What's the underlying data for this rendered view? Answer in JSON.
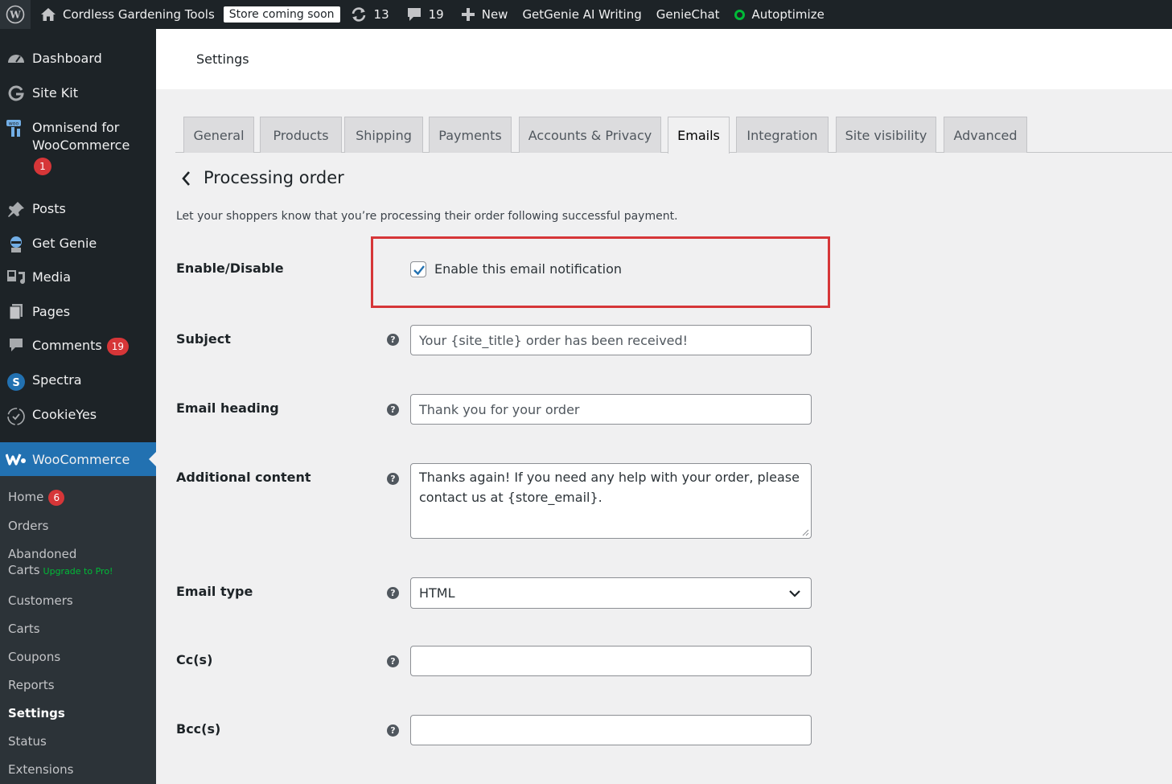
{
  "adminbar": {
    "site_name": "Cordless Gardening Tools",
    "store_badge": "Store coming soon",
    "updates_count": "13",
    "comments_count": "19",
    "new_label": "New",
    "getgenie_label": "GetGenie AI Writing",
    "geniechat_label": "GenieChat",
    "autoptimize_label": "Autoptimize"
  },
  "sidebar": {
    "items": [
      {
        "label": "Dashboard"
      },
      {
        "label": "Site Kit"
      },
      {
        "label": "Omnisend for WooCommerce",
        "badge": "1"
      },
      {
        "label": "Posts"
      },
      {
        "label": "Get Genie"
      },
      {
        "label": "Media"
      },
      {
        "label": "Pages"
      },
      {
        "label": "Comments",
        "badge": "19"
      },
      {
        "label": "Spectra"
      },
      {
        "label": "CookieYes"
      }
    ],
    "active": "WooCommerce",
    "submenu": {
      "home": "Home",
      "home_badge": "6",
      "orders": "Orders",
      "abandoned": "Abandoned",
      "carts_label": "Carts",
      "upgrade": "Upgrade to Pro!",
      "customers": "Customers",
      "carts": "Carts",
      "coupons": "Coupons",
      "reports": "Reports",
      "settings": "Settings",
      "status": "Status",
      "extensions": "Extensions"
    }
  },
  "header": {
    "title": "Settings"
  },
  "tabs": [
    "General",
    "Products",
    "Shipping",
    "Payments",
    "Accounts & Privacy",
    "Emails",
    "Integration",
    "Site visibility",
    "Advanced"
  ],
  "active_tab": "Emails",
  "page": {
    "title": "Processing order",
    "description": "Let your shoppers know that you’re processing their order following successful payment."
  },
  "form": {
    "enable_label": "Enable/Disable",
    "enable_checkbox_label": "Enable this email notification",
    "enable_checked": true,
    "subject_label": "Subject",
    "subject_placeholder": "Your {site_title} order has been received!",
    "heading_label": "Email heading",
    "heading_placeholder": "Thank you for your order",
    "additional_label": "Additional content",
    "additional_value": "Thanks again! If you need any help with your order, please contact us at {store_email}.",
    "type_label": "Email type",
    "type_value": "HTML",
    "cc_label": "Cc(s)",
    "cc_value": "",
    "bcc_label": "Bcc(s)",
    "bcc_value": "",
    "help_glyph": "?"
  },
  "colors": {
    "accent": "#2271b1",
    "highlight_box": "#d63638",
    "badge": "#d63638",
    "status_green": "#00ba37"
  }
}
